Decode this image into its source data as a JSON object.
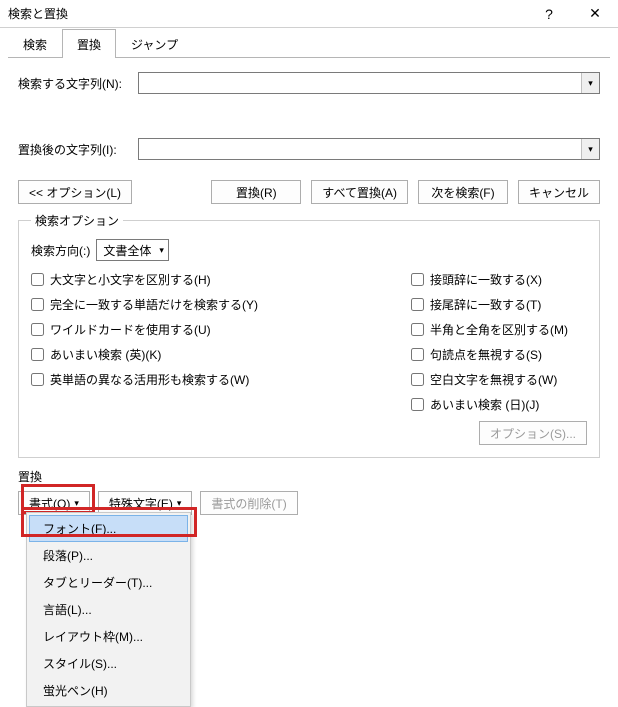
{
  "title": "検索と置換",
  "titlebar": {
    "help": "?",
    "close": "✕"
  },
  "tabs": {
    "find": "検索",
    "replace": "置換",
    "jump": "ジャンプ"
  },
  "fields": {
    "find_label": "検索する文字列(N):",
    "replace_label": "置換後の文字列(I):"
  },
  "buttons": {
    "options_collapse": "<< オプション(L)",
    "replace": "置換(R)",
    "replace_all": "すべて置換(A)",
    "find_next": "次を検索(F)",
    "cancel": "キャンセル"
  },
  "search_options": {
    "legend": "検索オプション",
    "direction_label": "検索方向(:)",
    "direction_value": "文書全体",
    "left": {
      "case": "大文字と小文字を区別する(H)",
      "whole": "完全に一致する単語だけを検索する(Y)",
      "wildcard": "ワイルドカードを使用する(U)",
      "fuzzy_en": "あいまい検索 (英)(K)",
      "wordforms": "英単語の異なる活用形も検索する(W)"
    },
    "right": {
      "prefix": "接頭辞に一致する(X)",
      "suffix": "接尾辞に一致する(T)",
      "width": "半角と全角を区別する(M)",
      "punct": "句読点を無視する(S)",
      "whitespace": "空白文字を無視する(W)",
      "fuzzy_ja": "あいまい検索 (日)(J)"
    },
    "options_s": "オプション(S)..."
  },
  "replace_section": {
    "heading": "置換",
    "format": "書式(O)",
    "special": "特殊文字(E)",
    "clear_format": "書式の削除(T)"
  },
  "format_menu": {
    "font": "フォント(F)...",
    "paragraph": "段落(P)...",
    "tabs": "タブとリーダー(T)...",
    "language": "言語(L)...",
    "frame": "レイアウト枠(M)...",
    "style": "スタイル(S)...",
    "highlight": "蛍光ペン(H)"
  }
}
